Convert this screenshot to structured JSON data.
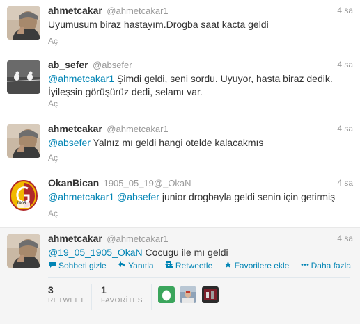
{
  "tweets": [
    {
      "fullname": "ahmetcakar",
      "username": "@ahmetcakar1",
      "time": "4 sa",
      "text": "Uyumusum biraz hastayım.Drogba saat kacta geldi",
      "action": "Aç",
      "avatar": "man-portrait-avatar"
    },
    {
      "fullname": "ab_sefer",
      "username": "@absefer",
      "time": "4 sa",
      "mention": "@ahmetcakar1",
      "text": " Şimdi geldi, seni sordu. Uyuyor, hasta biraz dedik. İyileşsin görüşürüz dedi, selamı var.",
      "action": "Aç",
      "avatar": "birds-on-wire-avatar"
    },
    {
      "fullname": "ahmetcakar",
      "username": "@ahmetcakar1",
      "time": "4 sa",
      "mention": "@absefer",
      "text": " Yalnız mı geldi hangi otelde kalacakmıs",
      "action": "Aç",
      "avatar": "man-portrait-avatar"
    },
    {
      "fullname": "OkanBican",
      "username": "1905_05_19@_OkaN",
      "time": "4 sa",
      "mention": "@ahmetcakar1",
      "mention2": "@absefer",
      "text": " junior drogbayla geldi senin için getirmiş",
      "action": "Aç",
      "avatar": "galatasaray-logo-avatar",
      "logo_text": "1905"
    },
    {
      "fullname": "ahmetcakar",
      "username": "@ahmetcakar1",
      "time": "4 sa",
      "mention": "@19_05_1905_OkaN",
      "text": " Cocugu ile mı geldi",
      "avatar": "man-portrait-avatar",
      "actions": [
        {
          "label": "Sohbeti gizle",
          "icon": "conversation-icon"
        },
        {
          "label": "Yanıtla",
          "icon": "reply-icon"
        },
        {
          "label": "Retweetle",
          "icon": "retweet-icon"
        },
        {
          "label": "Favorilere ekle",
          "icon": "star-icon"
        },
        {
          "label": "Daha fazla",
          "icon": "more-icon"
        }
      ],
      "stats": {
        "retweets": "3",
        "retweets_label": "RETWEET",
        "favorites": "1",
        "favorites_label": "FAVORİTES"
      }
    }
  ],
  "colors": {
    "link": "#0084b4",
    "muted": "#999999",
    "text": "#333333",
    "expanded_bg": "#f5f5f5"
  }
}
